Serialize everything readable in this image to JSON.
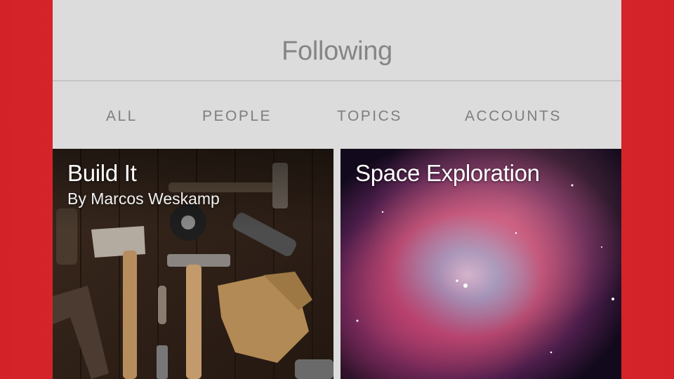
{
  "header": {
    "title": "Following"
  },
  "tabs": [
    {
      "label": "ALL"
    },
    {
      "label": "PEOPLE"
    },
    {
      "label": "TOPICS"
    },
    {
      "label": "ACCOUNTS"
    }
  ],
  "cards": [
    {
      "title": "Build It",
      "subtitle": "By Marcos Weskamp",
      "image": "tools-on-wooden-table-photo"
    },
    {
      "title": "Space Exploration",
      "image": "nebula-photo"
    }
  ],
  "colors": {
    "background": "#d32329",
    "panel": "#dcdcdc",
    "text": "#858585"
  }
}
